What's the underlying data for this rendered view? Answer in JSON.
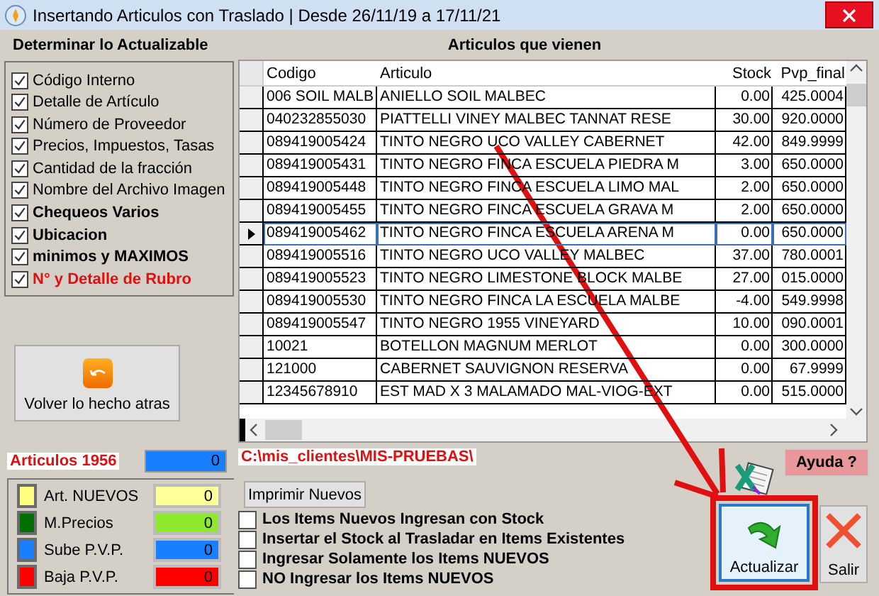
{
  "window": {
    "title": "Insertando Articulos con Traslado | Desde 26/11/19 a 17/11/21"
  },
  "update_panel": {
    "title": "Determinar lo Actualizable",
    "options": [
      {
        "label": "Código Interno",
        "checked": true,
        "kind": "normal"
      },
      {
        "label": "Detalle de Artículo",
        "checked": true,
        "kind": "normal"
      },
      {
        "label": "Número de Proveedor",
        "checked": true,
        "kind": "normal"
      },
      {
        "label": "Precios, Impuestos, Tasas",
        "checked": true,
        "kind": "normal"
      },
      {
        "label": "Cantidad de la fracción",
        "checked": true,
        "kind": "normal"
      },
      {
        "label": "Nombre del Archivo Imagen",
        "checked": true,
        "kind": "normal"
      },
      {
        "label": "Chequeos Varios",
        "checked": true,
        "kind": "bold"
      },
      {
        "label": "Ubicacion",
        "checked": true,
        "kind": "bold"
      },
      {
        "label": "minimos y MAXIMOS",
        "checked": true,
        "kind": "bold"
      },
      {
        "label": "N° y Detalle de Rubro",
        "checked": true,
        "kind": "warning"
      }
    ]
  },
  "undo_button": {
    "label": "Volver lo hecho atras"
  },
  "table": {
    "title": "Articulos que vienen",
    "columns": [
      "Codigo",
      "Articulo",
      "Stock",
      "Pvp_final"
    ],
    "rows": [
      {
        "cells": [
          "006 SOIL MALB",
          "ANIELLO SOIL MALBEC",
          "0.00",
          "425.0004"
        ],
        "selected": false
      },
      {
        "cells": [
          "040232855030",
          "PIATTELLI VINEY MALBEC TANNAT RESE",
          "30.00",
          "920.0000"
        ],
        "selected": false
      },
      {
        "cells": [
          "089419005424",
          "TINTO NEGRO UCO VALLEY CABERNET",
          "42.00",
          "849.9999"
        ],
        "selected": false
      },
      {
        "cells": [
          "089419005431",
          "TINTO NEGRO FINCA ESCUELA PIEDRA M",
          "3.00",
          "650.0000"
        ],
        "selected": false
      },
      {
        "cells": [
          "089419005448",
          "TINTO NEGRO FINCA ESCUELA LIMO MAL",
          "2.00",
          "650.0000"
        ],
        "selected": false
      },
      {
        "cells": [
          "089419005455",
          "TINTO NEGRO FINCA ESCUELA GRAVA M",
          "2.00",
          "650.0000"
        ],
        "selected": false
      },
      {
        "cells": [
          "089419005462",
          "TINTO NEGRO FINCA ESCUELA ARENA M",
          "0.00",
          "650.0000"
        ],
        "selected": true
      },
      {
        "cells": [
          "089419005516",
          "TINTO NEGRO UCO VALLEY MALBEC",
          "37.00",
          "780.0001"
        ],
        "selected": false
      },
      {
        "cells": [
          "089419005523",
          "TINTO NEGRO LIMESTONE BLOCK MALBE",
          "27.00",
          "015.0000"
        ],
        "selected": false
      },
      {
        "cells": [
          "089419005530",
          "TINTO NEGRO FINCA LA ESCUELA MALBE",
          "-4.00",
          "549.9998"
        ],
        "selected": false
      },
      {
        "cells": [
          "089419005547",
          "TINTO NEGRO 1955 VINEYARD",
          "10.00",
          "090.0001"
        ],
        "selected": false
      },
      {
        "cells": [
          "10021",
          "BOTELLON MAGNUM MERLOT",
          "0.00",
          "300.0000"
        ],
        "selected": false
      },
      {
        "cells": [
          "121000",
          "CABERNET SAUVIGNON RESERVA",
          "0.00",
          "67.9999"
        ],
        "selected": false
      },
      {
        "cells": [
          "12345678910",
          "EST MAD X 3 MALAMADO MAL-VIOG-EXT",
          "0.00",
          "515.0000"
        ],
        "selected": false
      }
    ]
  },
  "articles_count": {
    "label": "Articulos 1956",
    "value": "0"
  },
  "path": "C:\\mis_clientes\\MIS-PRUEBAS\\",
  "help_button": {
    "label": "Ayuda ?"
  },
  "legend": [
    {
      "label": "Art. NUEVOS",
      "color": "#ffff80",
      "field": {
        "value": "0",
        "color": "#ffff99"
      }
    },
    {
      "label": "M.Precios",
      "color": "#007000",
      "field": {
        "value": "0",
        "color": "#8ee82e"
      }
    },
    {
      "label": "Sube P.V.P.",
      "color": "#1a7fff",
      "field": {
        "value": "0",
        "color": "#1a7fff"
      }
    },
    {
      "label": "Baja P.V.P.",
      "color": "#ff0000",
      "field": {
        "value": "0",
        "color": "#ff0000"
      }
    }
  ],
  "print_button": {
    "label": "Imprimir Nuevos"
  },
  "import_options": [
    {
      "label": "Los Items Nuevos Ingresan con Stock",
      "checked": false
    },
    {
      "label": "Insertar el Stock al Trasladar en Items Existentes",
      "checked": false
    },
    {
      "label": "Ingresar Solamente los Items NUEVOS",
      "checked": false
    },
    {
      "label": "NO Ingresar los Items NUEVOS",
      "checked": false
    }
  ],
  "update_button": {
    "label": "Actualizar"
  },
  "exit_button": {
    "label": "Salir"
  }
}
